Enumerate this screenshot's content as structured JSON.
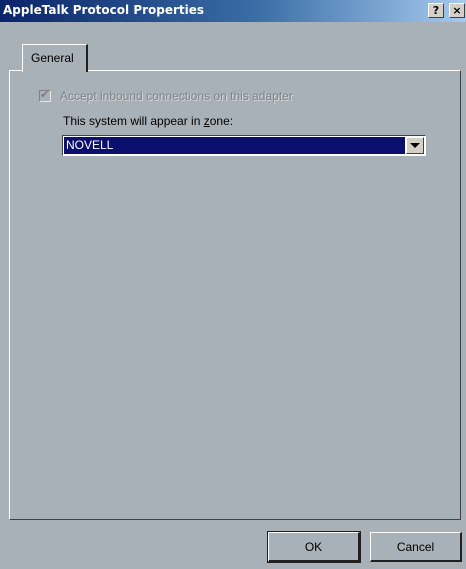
{
  "window": {
    "title": "AppleTalk Protocol Properties",
    "help_button": "?",
    "close_button": "×"
  },
  "tabs": [
    {
      "label": "General",
      "selected": true
    }
  ],
  "general": {
    "accept_inbound": {
      "label": "Accept inbound connections on this adapter",
      "checked": true,
      "enabled": false
    },
    "zone_label_before": "This system will appear in ",
    "zone_label_hotkey": "z",
    "zone_label_after": "one:",
    "zone_select": {
      "value": "NOVELL"
    }
  },
  "buttons": {
    "ok": "OK",
    "cancel": "Cancel"
  }
}
